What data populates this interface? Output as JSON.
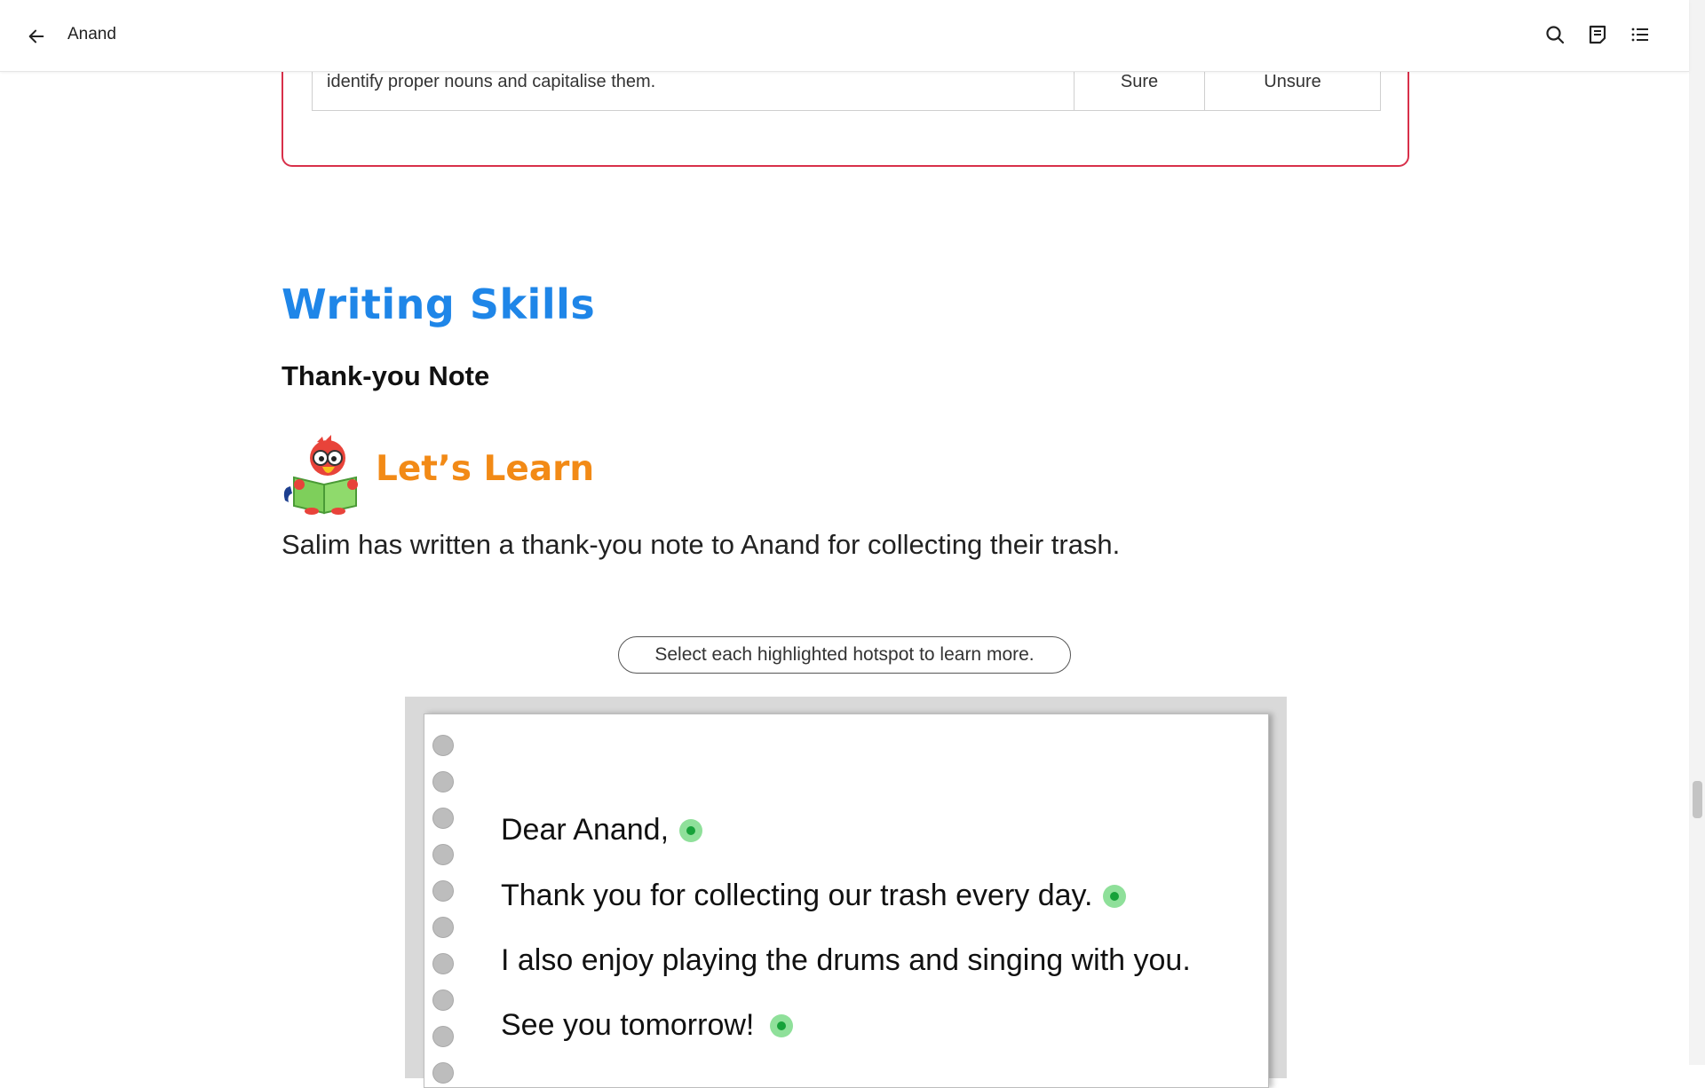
{
  "header": {
    "back_icon": "arrow-left-icon",
    "title": "Anand",
    "icons": [
      "search-icon",
      "notes-icon",
      "table-of-contents-icon"
    ]
  },
  "confidence_table": {
    "statement": "identify proper nouns and capitalise them.",
    "option_sure": "Sure",
    "option_unsure": "Unsure",
    "border_color": "#d8304a"
  },
  "section": {
    "title": "Writing Skills",
    "title_color": "#1f86e8",
    "subtitle": "Thank-you Note"
  },
  "lets_learn": {
    "mascot_icon": "reading-parrot-icon",
    "title": "Let’s Learn",
    "title_color": "#f28a16",
    "intro": "Salim has written a thank-you note to Anand for collecting their trash."
  },
  "hotspot_activity": {
    "instruction": "Select each highlighted hotspot to learn more.",
    "lines": [
      {
        "text": "Dear Anand,",
        "hotspot": true
      },
      {
        "text": "Thank you for collecting our trash every day.",
        "hotspot": true
      },
      {
        "text": "I also enjoy playing the drums and singing with you.",
        "hotspot": false
      },
      {
        "text": "See you tomorrow!",
        "hotspot": true
      }
    ],
    "hotspot_color": "#17a23a"
  }
}
